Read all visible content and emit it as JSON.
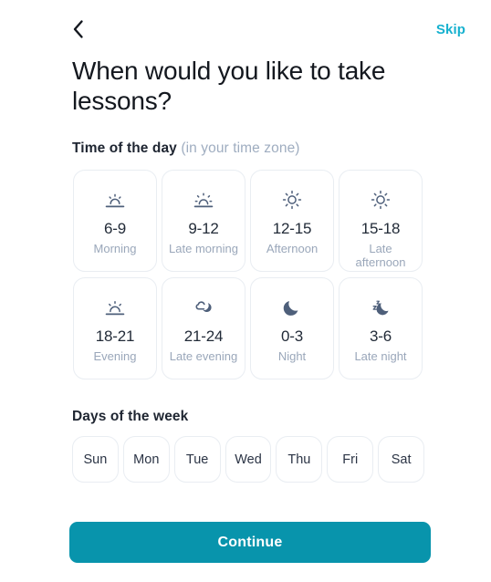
{
  "header": {
    "back_icon": "chevron-left-icon",
    "skip_label": "Skip"
  },
  "page_title": "When would you like to take lessons?",
  "time_section": {
    "label": "Time of the day",
    "label_muted": " (in your time zone)",
    "options": [
      {
        "range": "6-9",
        "label": "Morning",
        "icon": "sunrise-icon"
      },
      {
        "range": "9-12",
        "label": "Late morning",
        "icon": "sun-rising-icon"
      },
      {
        "range": "12-15",
        "label": "Afternoon",
        "icon": "sun-icon"
      },
      {
        "range": "15-18",
        "label": "Late afternoon",
        "icon": "sun-icon"
      },
      {
        "range": "18-21",
        "label": "Evening",
        "icon": "sunset-icon"
      },
      {
        "range": "21-24",
        "label": "Late evening",
        "icon": "moon-cloud-icon"
      },
      {
        "range": "0-3",
        "label": "Night",
        "icon": "moon-icon"
      },
      {
        "range": "3-6",
        "label": "Late night",
        "icon": "moon-zzz-icon"
      }
    ]
  },
  "days_section": {
    "label": "Days of the week",
    "days": [
      {
        "label": "Sun"
      },
      {
        "label": "Mon"
      },
      {
        "label": "Tue"
      },
      {
        "label": "Wed"
      },
      {
        "label": "Thu"
      },
      {
        "label": "Fri"
      },
      {
        "label": "Sat"
      }
    ]
  },
  "footer": {
    "continue_label": "Continue"
  },
  "colors": {
    "accent": "#0894ac",
    "skip": "#16b1cf",
    "icon": "#4e5f7a",
    "muted_text": "#9aa7ba",
    "border": "#e9edf2",
    "title_text": "#14181f"
  }
}
